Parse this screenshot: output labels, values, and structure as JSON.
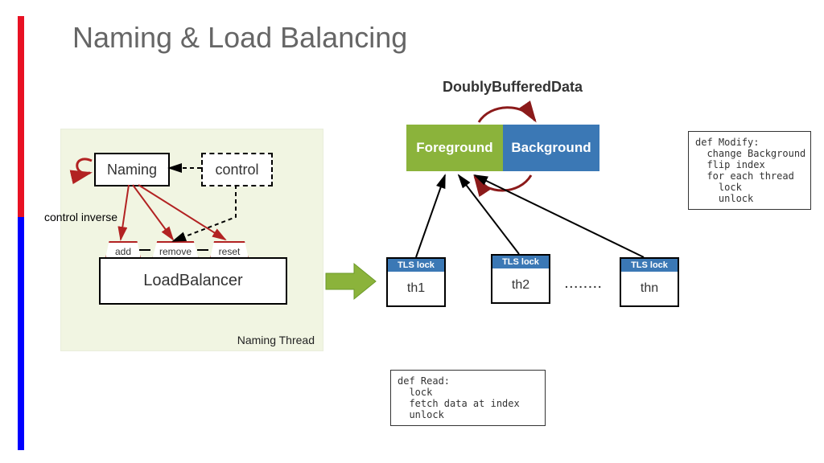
{
  "title": "Naming & Load Balancing",
  "left": {
    "caption": "Naming Thread",
    "naming": "Naming",
    "control": "control",
    "control_inverse": "control inverse",
    "tabs": {
      "add": "add",
      "remove": "remove",
      "reset": "reset"
    },
    "lb": "LoadBalancer"
  },
  "right": {
    "dbd": "DoublyBufferedData",
    "foreground": "Foreground",
    "background": "Background",
    "tls_lock": "TLS lock",
    "threads": {
      "t1": "th1",
      "t2": "th2",
      "tn": "thn"
    },
    "dots": "........"
  },
  "code": {
    "modify": "def Modify:\n  change Background\n  flip index\n  for each thread\n    lock\n    unlock",
    "read": "def Read:\n  lock\n  fetch data at index\n  unlock"
  }
}
